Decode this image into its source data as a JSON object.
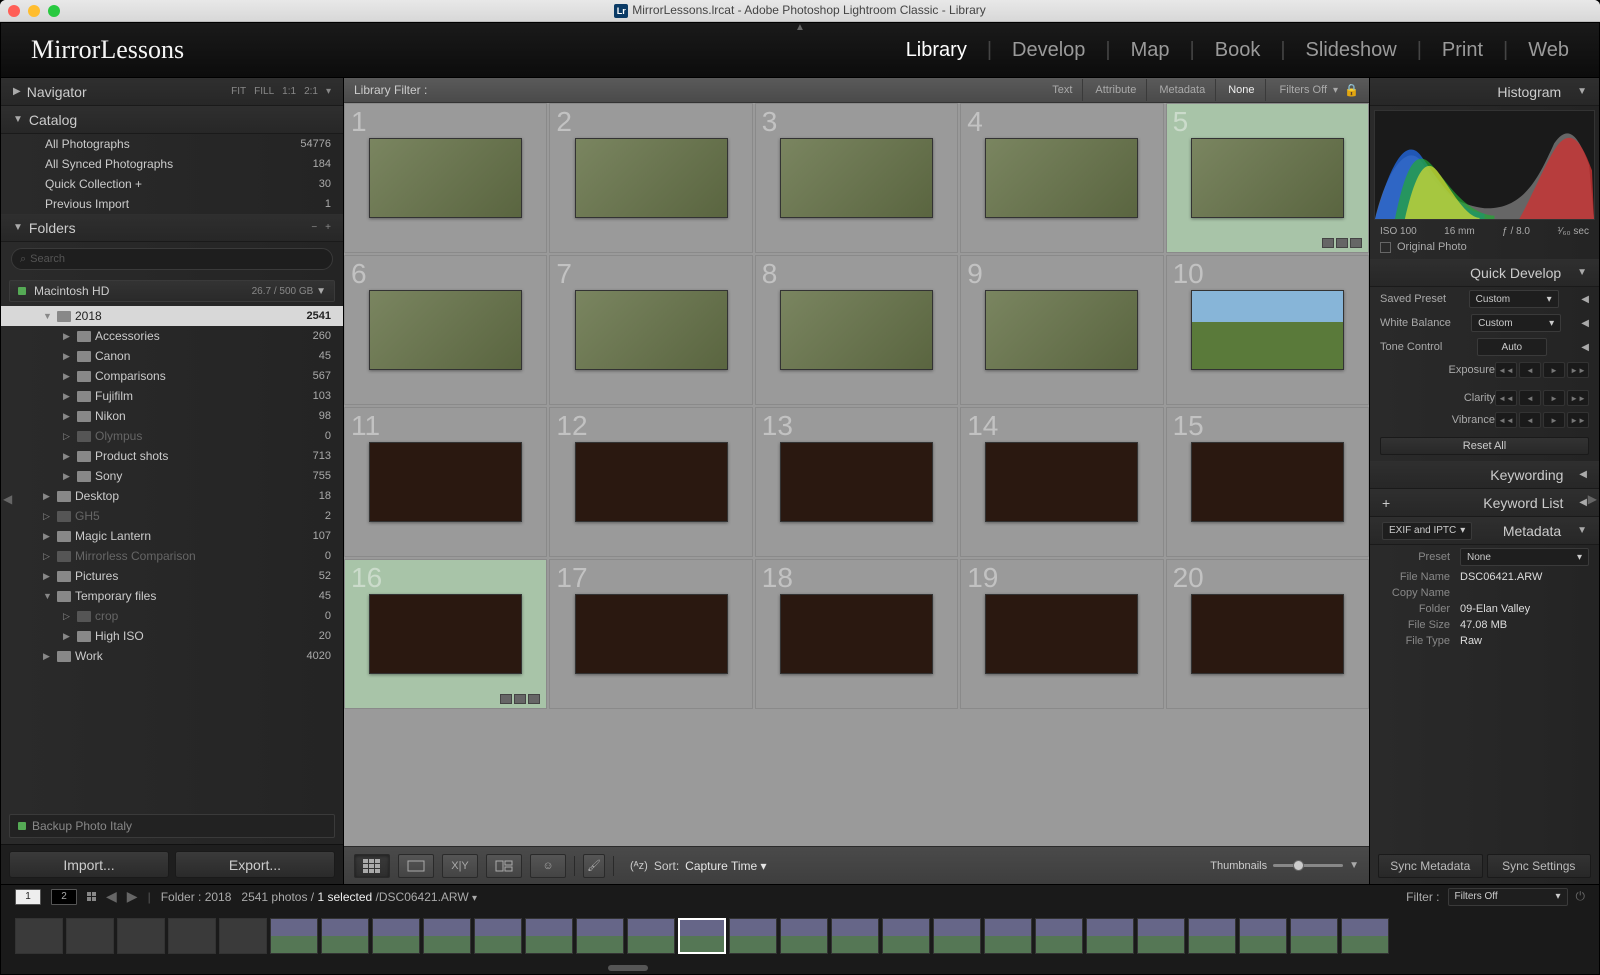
{
  "window_title": "MirrorLessons.lrcat - Adobe Photoshop Lightroom Classic - Library",
  "identity": "MirrorLessons",
  "modules": [
    "Library",
    "Develop",
    "Map",
    "Book",
    "Slideshow",
    "Print",
    "Web"
  ],
  "active_module": "Library",
  "navigator": {
    "title": "Navigator",
    "modes": [
      "FIT",
      "FILL",
      "1:1",
      "2:1"
    ]
  },
  "catalog": {
    "title": "Catalog",
    "items": [
      {
        "label": "All Photographs",
        "count": "54776"
      },
      {
        "label": "All Synced Photographs",
        "count": "184"
      },
      {
        "label": "Quick Collection  +",
        "count": "30"
      },
      {
        "label": "Previous Import",
        "count": "1"
      }
    ]
  },
  "folders": {
    "title": "Folders",
    "search_placeholder": "Search",
    "volume": {
      "name": "Macintosh HD",
      "space": "26.7 / 500 GB"
    },
    "tree": [
      {
        "label": "2018",
        "count": "2541",
        "indent": 1,
        "open": true,
        "selected": true
      },
      {
        "label": "Accessories",
        "count": "260",
        "indent": 2
      },
      {
        "label": "Canon",
        "count": "45",
        "indent": 2
      },
      {
        "label": "Comparisons",
        "count": "567",
        "indent": 2
      },
      {
        "label": "Fujifilm",
        "count": "103",
        "indent": 2
      },
      {
        "label": "Nikon",
        "count": "98",
        "indent": 2
      },
      {
        "label": "Olympus",
        "count": "0",
        "indent": 2,
        "dim": true
      },
      {
        "label": "Product shots",
        "count": "713",
        "indent": 2
      },
      {
        "label": "Sony",
        "count": "755",
        "indent": 2
      },
      {
        "label": "Desktop",
        "count": "18",
        "indent": 1
      },
      {
        "label": "GH5",
        "count": "2",
        "indent": 1,
        "dim": true
      },
      {
        "label": "Magic Lantern",
        "count": "107",
        "indent": 1
      },
      {
        "label": "Mirrorless Comparison",
        "count": "0",
        "indent": 1,
        "dim": true
      },
      {
        "label": "Pictures",
        "count": "52",
        "indent": 1
      },
      {
        "label": "Temporary files",
        "count": "45",
        "indent": 1,
        "open": true
      },
      {
        "label": "crop",
        "count": "0",
        "indent": 2,
        "dim": true
      },
      {
        "label": "High ISO",
        "count": "20",
        "indent": 2
      },
      {
        "label": "Work",
        "count": "4020",
        "indent": 1
      }
    ],
    "backup": "Backup Photo Italy"
  },
  "import_label": "Import...",
  "export_label": "Export...",
  "filter_bar": {
    "label": "Library Filter :",
    "tabs": [
      "Text",
      "Attribute",
      "Metadata",
      "None"
    ],
    "active_tab": "None",
    "right": "Filters Off"
  },
  "grid": {
    "cells": [
      {
        "n": 1,
        "t": "bird"
      },
      {
        "n": 2,
        "t": "bird"
      },
      {
        "n": 3,
        "t": "bird"
      },
      {
        "n": 4,
        "t": "bird"
      },
      {
        "n": 5,
        "t": "bird",
        "sel": true,
        "badges": true
      },
      {
        "n": 6,
        "t": "bird"
      },
      {
        "n": 7,
        "t": "bird"
      },
      {
        "n": 8,
        "t": "bird"
      },
      {
        "n": 9,
        "t": "bird"
      },
      {
        "n": 10,
        "t": "sky"
      },
      {
        "n": 11,
        "t": "night"
      },
      {
        "n": 12,
        "t": "night"
      },
      {
        "n": 13,
        "t": "night"
      },
      {
        "n": 14,
        "t": "night"
      },
      {
        "n": 15,
        "t": "night"
      },
      {
        "n": 16,
        "t": "night",
        "sel": true,
        "badges": true
      },
      {
        "n": 17,
        "t": "night"
      },
      {
        "n": 18,
        "t": "night"
      },
      {
        "n": 19,
        "t": "night"
      },
      {
        "n": 20,
        "t": "night"
      }
    ]
  },
  "toolbar": {
    "sort_label": "Sort:",
    "sort_value": "Capture Time",
    "thumb_label": "Thumbnails"
  },
  "histogram": {
    "title": "Histogram",
    "iso": "ISO 100",
    "focal": "16 mm",
    "aperture": "ƒ / 8.0",
    "shutter": "¹⁄₆₀ sec",
    "checkbox": "Original Photo"
  },
  "quick_develop": {
    "title": "Quick Develop",
    "saved_preset_label": "Saved Preset",
    "saved_preset_value": "Custom",
    "wb_label": "White Balance",
    "wb_value": "Custom",
    "tone_label": "Tone Control",
    "tone_btn": "Auto",
    "exposure": "Exposure",
    "clarity": "Clarity",
    "vibrance": "Vibrance",
    "reset": "Reset All"
  },
  "keywording_title": "Keywording",
  "keyword_list_title": "Keyword List",
  "metadata": {
    "title": "Metadata",
    "preset_dropdown": "EXIF and IPTC",
    "preset_label": "Preset",
    "preset_value": "None",
    "rows": [
      {
        "label": "File Name",
        "val": "DSC06421.ARW"
      },
      {
        "label": "Copy Name",
        "val": ""
      },
      {
        "label": "Folder",
        "val": "09-Elan Valley"
      },
      {
        "label": "File Size",
        "val": "47.08 MB"
      },
      {
        "label": "File Type",
        "val": "Raw"
      }
    ]
  },
  "sync_metadata": "Sync Metadata",
  "sync_settings": "Sync Settings",
  "status": {
    "folder": "Folder : 2018",
    "photos": "2541 photos /",
    "selected": "1 selected",
    "filename": "/DSC06421.ARW",
    "filter_label": "Filter :",
    "filter_value": "Filters Off"
  }
}
